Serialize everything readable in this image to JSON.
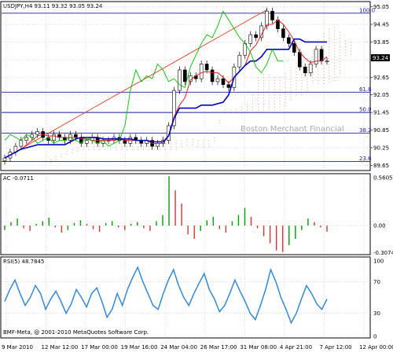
{
  "chart_data": [
    {
      "type": "candlestick",
      "title": "USDJPY,H4  93.11 93.32 93.05 93.24",
      "symbol": "USDJPY,H4",
      "ohlc_header": [
        "93.11",
        "93.32",
        "93.05",
        "93.24"
      ],
      "ylim": [
        89.5,
        95.2
      ],
      "yticks": [
        "95.05",
        "94.45",
        "93.85",
        "93.24",
        "92.65",
        "92.05",
        "91.45",
        "90.85",
        "90.25",
        "89.65"
      ],
      "current_price": "93.24",
      "close_prices": [
        89.9,
        90.1,
        90.3,
        90.5,
        90.6,
        90.7,
        90.8,
        90.6,
        90.5,
        90.7,
        90.6,
        90.5,
        90.7,
        90.6,
        90.4,
        90.5,
        90.6,
        90.4,
        90.5,
        90.5,
        90.6,
        90.5,
        90.4,
        90.6,
        90.5,
        90.4,
        90.5,
        90.3,
        90.4,
        90.5,
        91.0,
        92.2,
        92.9,
        92.5,
        92.7,
        92.6,
        93.1,
        92.9,
        92.5,
        92.6,
        92.4,
        92.3,
        93.0,
        93.4,
        93.8,
        94.1,
        94.0,
        94.4,
        94.9,
        94.6,
        94.3,
        94.0,
        93.8,
        93.5,
        93.0,
        92.8,
        93.1,
        93.6,
        93.2,
        93.2
      ],
      "fib_levels": [
        {
          "label": "100.0",
          "price": 94.83
        },
        {
          "label": "61.8",
          "price": 92.14
        },
        {
          "label": "50.0",
          "price": 91.45
        },
        {
          "label": "38.2",
          "price": 90.75
        },
        {
          "label": "23.6",
          "price": 89.78
        }
      ],
      "watermark": "Boston Merchant Financial"
    },
    {
      "type": "histogram",
      "title": "AC -0.0711",
      "indicator": "AC",
      "value_label": "-0.0711",
      "yticks": [
        "0.5605",
        "0.00",
        "-0.3074"
      ],
      "ylim": [
        -0.32,
        0.58
      ],
      "values": [
        -0.05,
        0.04,
        0.08,
        -0.03,
        -0.06,
        0.02,
        0.05,
        0.09,
        -0.02,
        -0.08,
        -0.05,
        0.03,
        0.06,
        0.02,
        -0.04,
        -0.07,
        0.03,
        0.05,
        -0.02,
        -0.05,
        0.02,
        0.04,
        -0.03,
        -0.06,
        0.05,
        0.12,
        0.56,
        0.4,
        0.25,
        -0.1,
        -0.15,
        -0.06,
        0.06,
        0.1,
        -0.04,
        -0.08,
        0.05,
        0.12,
        0.2,
        0.1,
        -0.03,
        -0.12,
        -0.2,
        -0.28,
        -0.3,
        -0.22,
        -0.15,
        -0.05,
        0.08,
        0.04,
        -0.02,
        -0.07
      ]
    },
    {
      "type": "line",
      "title": "RSI(5) 48.7845",
      "indicator": "RSI(5)",
      "value_label": "48.7845",
      "yticks": [
        "100",
        "70",
        "30",
        "0"
      ],
      "ylim": [
        0,
        100
      ],
      "values": [
        45,
        60,
        72,
        55,
        40,
        50,
        65,
        55,
        35,
        48,
        58,
        45,
        30,
        42,
        60,
        50,
        38,
        55,
        62,
        45,
        25,
        35,
        55,
        40,
        60,
        75,
        88,
        70,
        55,
        40,
        35,
        55,
        72,
        85,
        65,
        50,
        40,
        55,
        68,
        80,
        60,
        48,
        32,
        40,
        55,
        72,
        58,
        45,
        30,
        22,
        40,
        60,
        85,
        70,
        50,
        35,
        18,
        30,
        48,
        65,
        55,
        42,
        35,
        48
      ]
    }
  ],
  "x_labels": [
    "9 Mar 2010",
    "12 Mar 12:00",
    "17 Mar 00:00",
    "19 Mar 16:00",
    "24 Mar 04:00",
    "26 Mar 17:00",
    "31 Mar 08:00",
    "4 Apr 21:00",
    "7 Apr 12:00",
    "12 Apr 00:00"
  ],
  "copyright": "BMF-Meta, @ 2001-2010 MetaQuotes Software Corp.",
  "colors": {
    "bull_candle": "#000000",
    "bear_candle": "#000000",
    "kijun_blue": "#0000c0",
    "tenkan_red": "#e02020",
    "chikou_green": "#00c000",
    "cloud_dots": "#e0a080",
    "fib_line": "#1a1aa0",
    "trend_line": "#e04020",
    "ac_up": "#00a000",
    "ac_down": "#e03030",
    "rsi_line": "#3388dd",
    "grid": "#c8c8c8"
  }
}
